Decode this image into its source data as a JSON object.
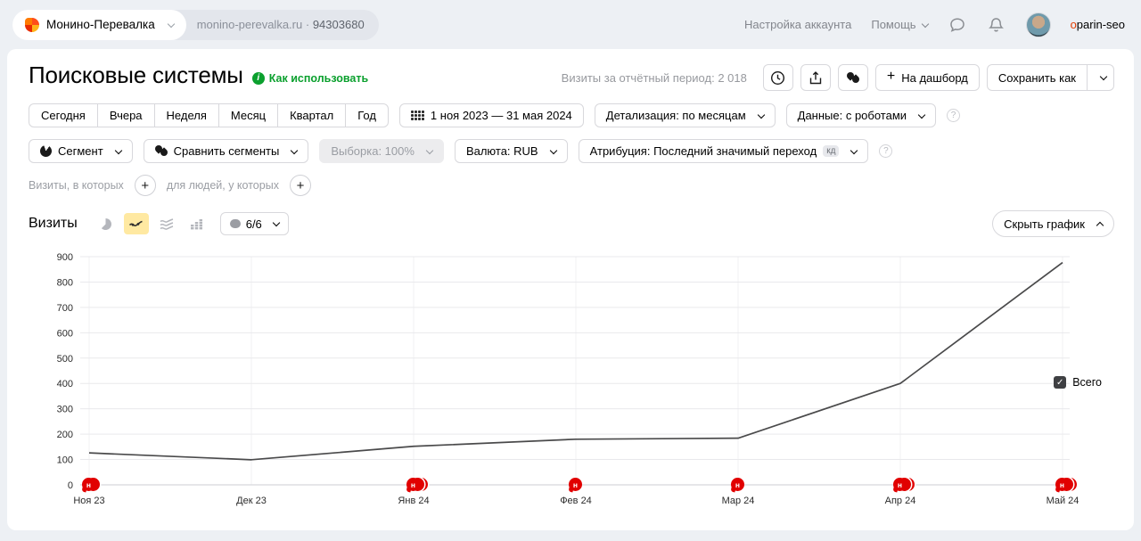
{
  "header": {
    "counter_name": "Монино-Перевалка",
    "counter_domain": "monino-perevalka.ru",
    "counter_id": "94303680",
    "account_settings": "Настройка аккаунта",
    "help": "Помощь",
    "username_first": "o",
    "username_rest": "parin-seo"
  },
  "report": {
    "title": "Поисковые системы",
    "how_to_use": "Как использовать",
    "period_total_label": "Визиты за отчётный период:",
    "period_total_value": "2 018"
  },
  "toolbar": {
    "to_dashboard": "На дашборд",
    "save_as": "Сохранить как"
  },
  "filters": {
    "quick_ranges": [
      "Сегодня",
      "Вчера",
      "Неделя",
      "Месяц",
      "Квартал",
      "Год"
    ],
    "date_range": "1 ноя 2023 — 31 мая 2024",
    "detalization": "Детализация: по месяцам",
    "data_mode": "Данные: с роботами",
    "segment": "Сегмент",
    "compare_segments": "Сравнить сегменты",
    "sampling": "Выборка: 100%",
    "currency": "Валюта: RUB",
    "attribution": "Атрибуция: Последний значимый переход",
    "attribution_badge": "кд",
    "visits_in_which": "Визиты, в которых",
    "for_people": "для людей, у которых"
  },
  "metric_row": {
    "label": "Визиты",
    "comments": "6/6",
    "hide_chart": "Скрыть график"
  },
  "legend": {
    "total": "Всего"
  },
  "icons": {
    "plus": "+",
    "question": "?",
    "info": "i",
    "check": "✓",
    "annotation_letter": "н",
    "meta_separator": "·"
  },
  "chart_data": {
    "type": "line",
    "title": "Визиты",
    "x": [
      "Ноя 23",
      "Дек 23",
      "Янв 24",
      "Фев 24",
      "Мар 24",
      "Апр 24",
      "Май 24"
    ],
    "series": [
      {
        "name": "Всего",
        "values": [
          126,
          99,
          152,
          180,
          184,
          400,
          877
        ]
      }
    ],
    "ylim": [
      0,
      900
    ],
    "ytick_step": 100,
    "grid": true,
    "legend_position": "right",
    "line_color": "#4a4a4b",
    "annotation_color": "#e10000",
    "annotations_per_month": [
      2,
      0,
      3,
      1,
      1,
      3,
      3
    ]
  }
}
